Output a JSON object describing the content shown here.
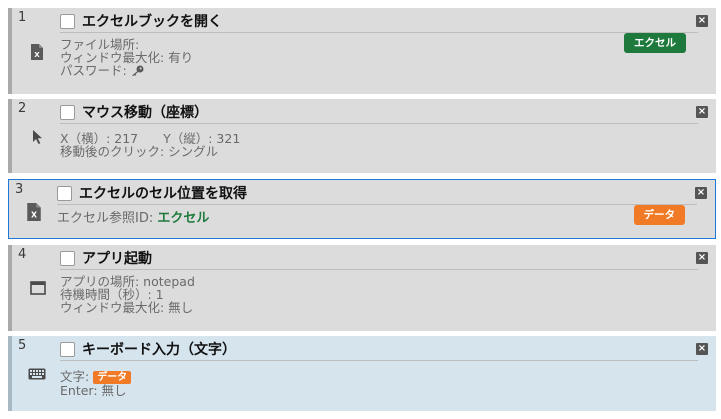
{
  "steps": [
    {
      "num": "1",
      "title": "エクセルブックを開く",
      "icon": "excel-file-icon",
      "lines": [
        "ファイル場所:",
        "ウィンドウ最大化: 有り",
        "パスワード:"
      ],
      "badge": "エクセル",
      "badge_color": "#1e7a3c"
    },
    {
      "num": "2",
      "title": "マウス移動（座標）",
      "icon": "mouse-pointer-icon",
      "lines": [
        "X（横）: 217　　Y（縦）: 321",
        "移動後のクリック: シングル"
      ]
    },
    {
      "num": "3",
      "title": "エクセルのセル位置を取得",
      "icon": "excel-file-icon",
      "ref_label": "エクセル参照ID: ",
      "ref_value": "エクセル",
      "badge": "データ",
      "badge_color": "#f07a25"
    },
    {
      "num": "4",
      "title": "アプリ起動",
      "icon": "window-icon",
      "lines": [
        "アプリの場所: notepad",
        "待機時間（秒）: 1",
        "ウィンドウ最大化: 無し"
      ]
    },
    {
      "num": "5",
      "title": "キーボード入力（文字）",
      "icon": "keyboard-icon",
      "text_label": "文字: ",
      "text_badge": "データ",
      "lines": [
        "Enter: 無し"
      ]
    }
  ],
  "close_glyph": "×"
}
